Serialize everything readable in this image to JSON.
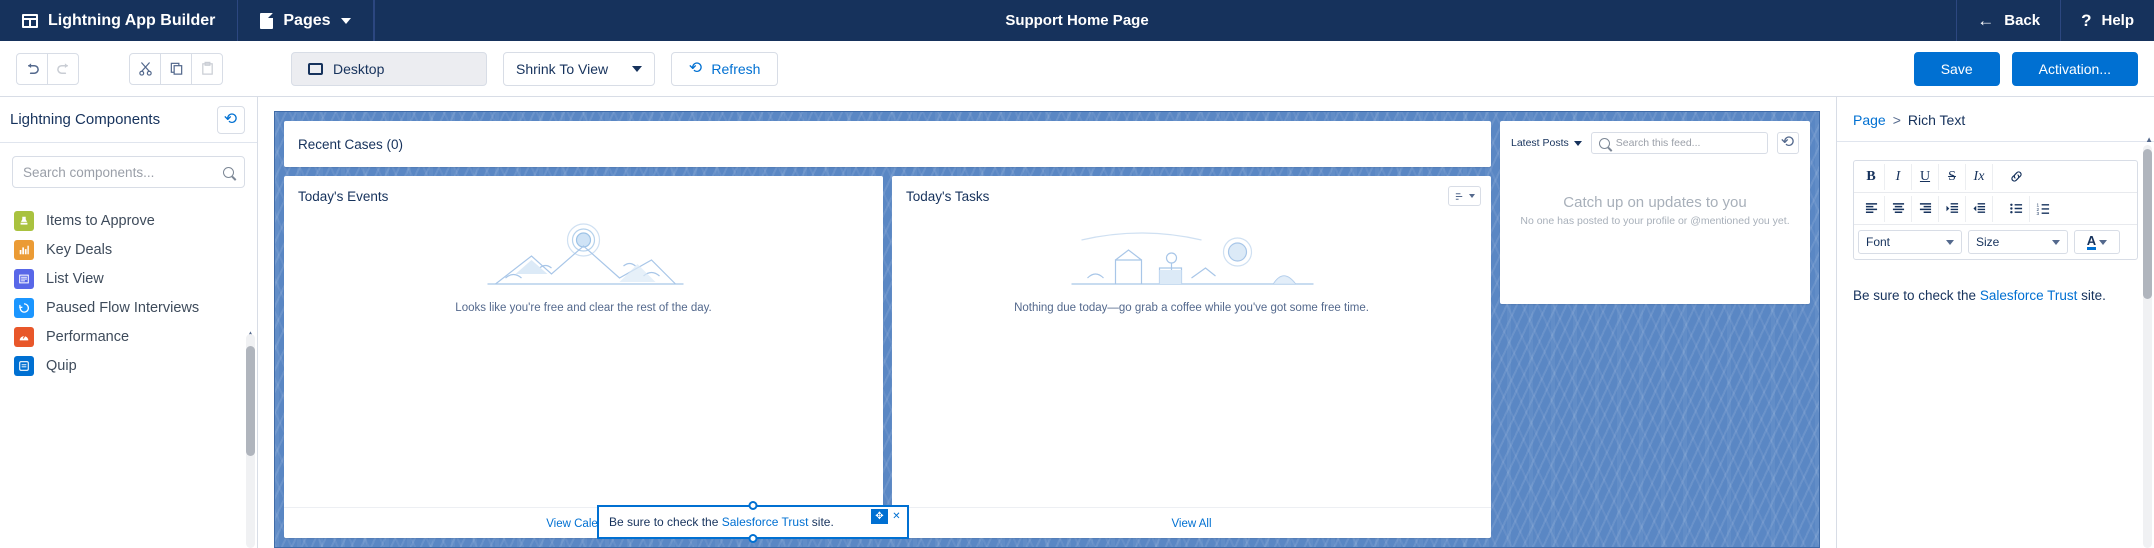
{
  "header": {
    "app_name": "Lightning App Builder",
    "app_icon": "grid-icon",
    "pages_label": "Pages",
    "pages_icon": "document-icon",
    "page_title": "Support Home Page",
    "back_label": "Back",
    "back_icon": "arrow-left-icon",
    "help_label": "Help",
    "help_icon": "question-mark-icon",
    "background": "#16325c"
  },
  "toolbar": {
    "undo_icon": "undo-icon",
    "redo_icon": "redo-icon",
    "cut_icon": "scissors-icon",
    "copy_icon": "copy-icon",
    "paste_icon": "paste-icon",
    "device_label": "Desktop",
    "device_icon": "monitor-icon",
    "zoom_label": "Shrink To View",
    "refresh_label": "Refresh",
    "refresh_icon": "refresh-icon",
    "save_label": "Save",
    "activation_label": "Activation...",
    "accent": "#0070d2"
  },
  "sidebar": {
    "title": "Lightning Components",
    "refresh_icon": "refresh-icon",
    "search_placeholder": "Search components...",
    "search_value": "",
    "search_icon": "search-icon",
    "items": [
      {
        "label": "Items to Approve",
        "icon": "approval-stamp-icon",
        "color": "#a9c23f",
        "glyph": "⚑"
      },
      {
        "label": "Key Deals",
        "icon": "bar-chart-icon",
        "color": "#eb9b35",
        "glyph": "▐"
      },
      {
        "label": "List View",
        "icon": "list-view-icon",
        "color": "#5867e8",
        "glyph": "☰"
      },
      {
        "label": "Paused Flow Interviews",
        "icon": "flow-icon",
        "color": "#1b96ff",
        "glyph": "↻"
      },
      {
        "label": "Performance",
        "icon": "performance-icon",
        "color": "#e8572a",
        "glyph": "◥"
      },
      {
        "label": "Quip",
        "icon": "quip-icon",
        "color": "#0070d2",
        "glyph": "▣"
      }
    ]
  },
  "canvas": {
    "recent_cases_title": "Recent Cases (0)",
    "events": {
      "title": "Today's Events",
      "empty_message": "Looks like you're free and clear the rest of the day.",
      "footer_link": "View Calendar"
    },
    "tasks": {
      "title": "Today's Tasks",
      "empty_message": "Nothing due today—go grab a coffee while you've got some free time.",
      "footer_link": "View All",
      "sort_icon": "sort-icon"
    },
    "feed": {
      "filter_label": "Latest Posts",
      "search_placeholder": "Search this feed...",
      "refresh_icon": "refresh-icon",
      "empty_title": "Catch up on updates to you",
      "empty_sub": "No one has posted to your profile or @mentioned you yet."
    },
    "selected_component": {
      "text_before": "Be sure to check the ",
      "link_text": "Salesforce Trust",
      "text_after": " site.",
      "move_icon": "move-handle-icon",
      "close_icon": "close-icon",
      "selection_color": "#0070d2"
    }
  },
  "right_panel": {
    "breadcrumb_root": "Page",
    "breadcrumb_sep": ">",
    "breadcrumb_current": "Rich Text",
    "rte": {
      "bold": "B",
      "italic": "I",
      "underline": "U",
      "strike": "S",
      "clear_format": "Ix",
      "link_icon": "link-icon",
      "align_left_icon": "align-left-icon",
      "align_center_icon": "align-center-icon",
      "align_right_icon": "align-right-icon",
      "indent_icon": "indent-icon",
      "outdent_icon": "outdent-icon",
      "bullet_list_icon": "bullet-list-icon",
      "numbered_list_icon": "numbered-list-icon",
      "font_label": "Font",
      "size_label": "Size",
      "text_color_label": "A",
      "text_color_icon": "text-color-icon"
    },
    "content": {
      "text_before": "Be sure to check the ",
      "link_text": "Salesforce Trust",
      "text_after": " site."
    }
  }
}
